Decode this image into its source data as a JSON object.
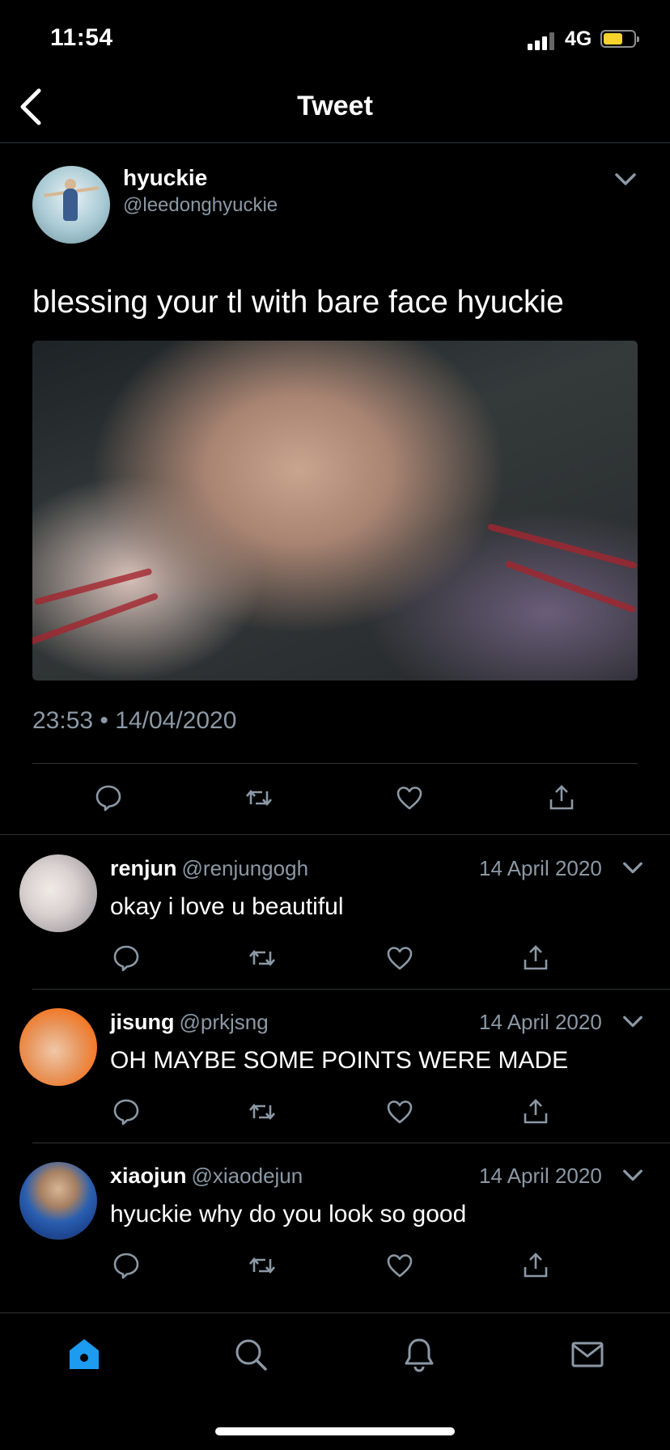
{
  "status_bar": {
    "time": "11:54",
    "network": "4G"
  },
  "nav": {
    "title": "Tweet"
  },
  "tweet": {
    "name": "hyuckie",
    "handle": "@leedonghyuckie",
    "text": "blessing your tl with bare face hyuckie",
    "timestamp": "23:53 • 14/04/2020"
  },
  "replies": [
    {
      "name": "renjun",
      "handle": "@renjungogh",
      "date": "14 April 2020",
      "text": "okay i love u beautiful"
    },
    {
      "name": "jisung",
      "handle": "@prkjsng",
      "date": "14 April 2020",
      "text": "OH MAYBE SOME POINTS WERE MADE"
    },
    {
      "name": "xiaojun",
      "handle": "@xiaodejun",
      "date": "14 April 2020",
      "text": "hyuckie why do you look so good"
    }
  ],
  "colors": {
    "background": "#000000",
    "secondary_text": "#8b98a5",
    "accent": "#1d9bf0",
    "divider": "#2f3336",
    "battery": "#f7d22d"
  },
  "icons": {
    "actions": [
      "reply-icon",
      "retweet-icon",
      "like-icon",
      "share-icon"
    ],
    "tab_bar": [
      "home-icon",
      "search-icon",
      "notifications-icon",
      "messages-icon"
    ]
  }
}
